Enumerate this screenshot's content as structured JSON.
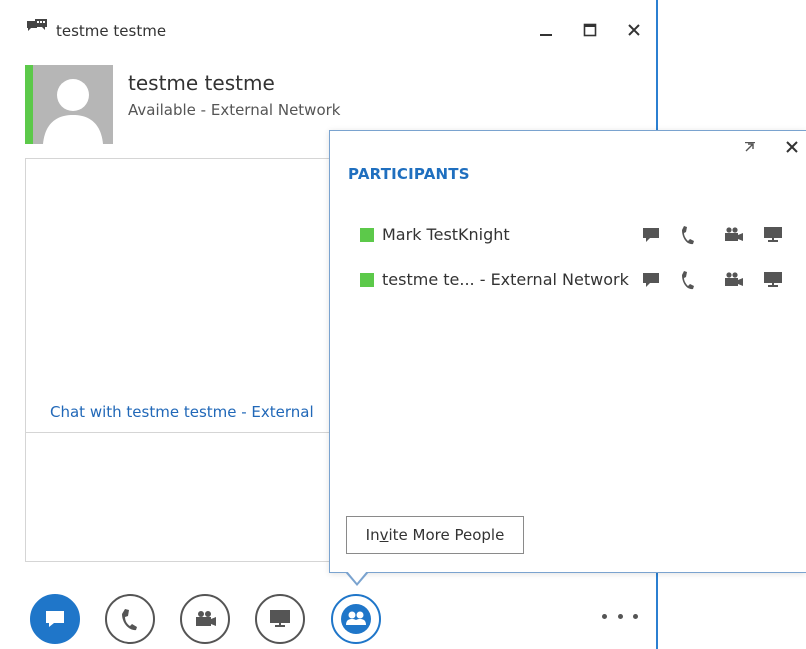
{
  "window": {
    "title": "testme testme",
    "controls": {
      "minimize": "minimize-icon",
      "maximize": "maximize-icon",
      "close": "close-icon"
    }
  },
  "contact": {
    "name": "testme testme",
    "status": "Available - External Network",
    "status_color": "#5cc94a"
  },
  "chat": {
    "info_line": "Chat with testme testme - External"
  },
  "participants_panel": {
    "title": "PARTICIPANTS",
    "participants": [
      {
        "name": "Mark TestKnight",
        "status_color": "#5cc94a"
      },
      {
        "name": "testme te...  - External Network",
        "status_color": "#5cc94a"
      }
    ],
    "invite_button": {
      "pre": "In",
      "underlined": "v",
      "post": "ite More People"
    }
  },
  "toolbar": {
    "buttons": [
      "im-icon",
      "call-icon",
      "video-icon",
      "screen-share-icon",
      "participants-icon"
    ],
    "active_color": "#1f76c9",
    "more": "more-options-icon"
  }
}
